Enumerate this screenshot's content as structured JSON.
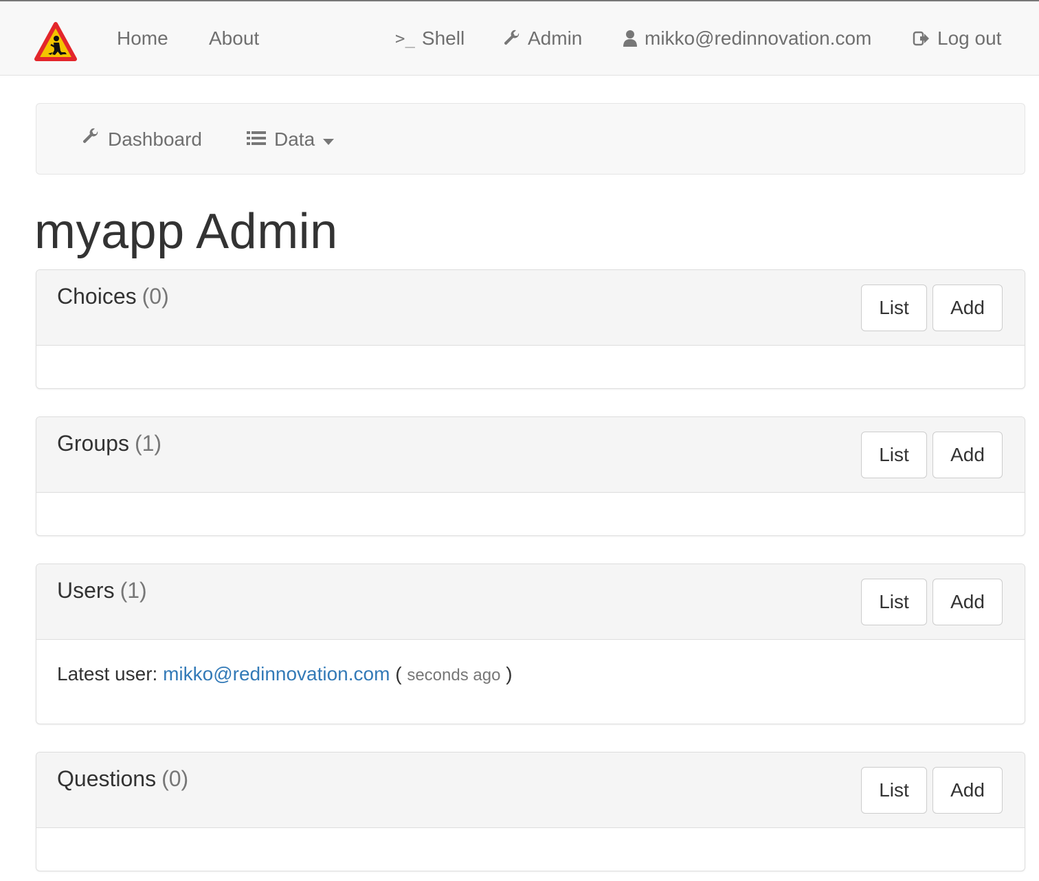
{
  "nav": {
    "home": "Home",
    "about": "About",
    "shell": "Shell",
    "shell_prompt": ">_",
    "admin": "Admin",
    "user_email": "mikko@redinnovation.com",
    "logout": "Log out"
  },
  "icons": {
    "logo": "roadwork-warning-sign",
    "admin": "wrench-icon",
    "user": "user-icon",
    "logout": "logout-icon",
    "dashboard": "wrench-icon",
    "data": "list-icon",
    "caret": "caret-down-icon"
  },
  "subnav": {
    "dashboard": "Dashboard",
    "data": "Data"
  },
  "page": {
    "title": "myapp Admin"
  },
  "panels": [
    {
      "name": "Choices",
      "count": "(0)",
      "list_label": "List",
      "add_label": "Add"
    },
    {
      "name": "Groups",
      "count": "(1)",
      "list_label": "List",
      "add_label": "Add"
    },
    {
      "name": "Users",
      "count": "(1)",
      "list_label": "List",
      "add_label": "Add",
      "latest_label": "Latest user:",
      "latest_email": "mikko@redinnovation.com",
      "open_paren": "(",
      "latest_time": "seconds ago",
      "close_paren": ")"
    },
    {
      "name": "Questions",
      "count": "(0)",
      "list_label": "List",
      "add_label": "Add"
    }
  ],
  "colors": {
    "link": "#337ab7",
    "navbar_bg": "#f8f8f8",
    "panel_heading_bg": "#f5f5f5",
    "logo_red": "#e3262b",
    "logo_yellow": "#f4c400"
  }
}
